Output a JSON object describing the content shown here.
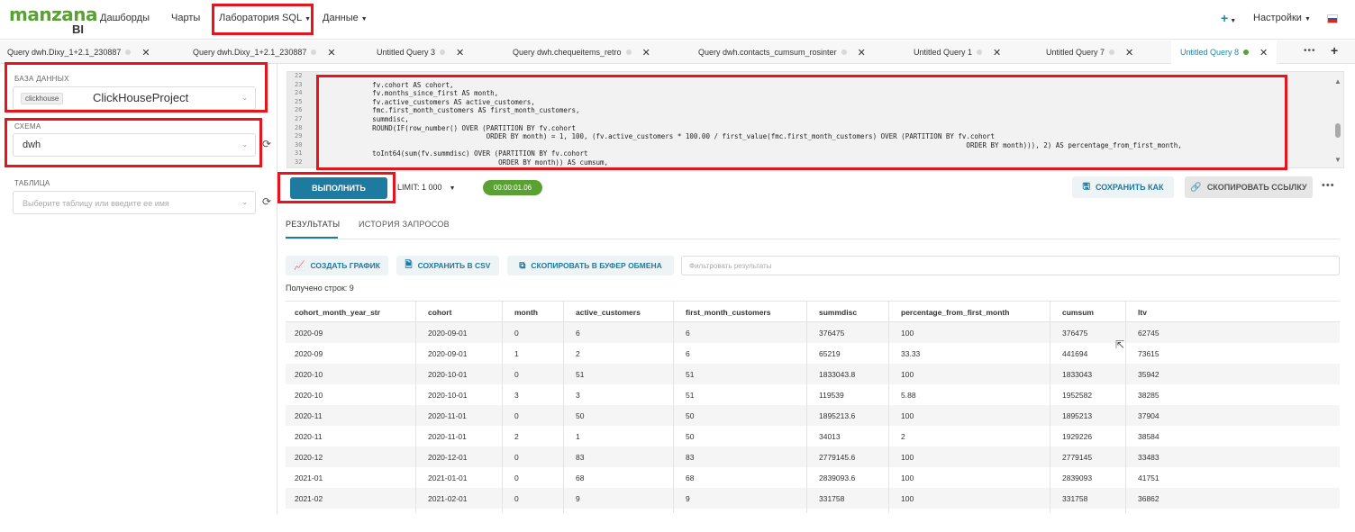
{
  "nav": {
    "brand": "manzana",
    "brand_sub": "BI",
    "items": [
      {
        "label": "Дашборды",
        "has_caret": false
      },
      {
        "label": "Чарты",
        "has_caret": false
      },
      {
        "label": "Лаборатория SQL",
        "has_caret": true
      },
      {
        "label": "Данные",
        "has_caret": true
      }
    ],
    "settings_label": "Настройки",
    "plus_label": "+"
  },
  "tabs": [
    {
      "label": "Query dwh.Dixy_1+2.1_230887"
    },
    {
      "label": "Query dwh.Dixy_1+2.1_230887"
    },
    {
      "label": "Untitled Query 3"
    },
    {
      "label": "Query dwh.chequeitems_retro"
    },
    {
      "label": "Query dwh.contacts_cumsum_rosinter"
    },
    {
      "label": "Untitled Query 1"
    },
    {
      "label": "Untitled Query 7"
    },
    {
      "label": "Untitled Query 8",
      "active": true
    }
  ],
  "left": {
    "db_label": "БАЗА ДАННЫХ",
    "db_tag": "clickhouse",
    "db_name": "ClickHouseProject",
    "schema_label": "СХЕМА",
    "schema_value": "dwh",
    "table_label": "ТАБЛИЦА",
    "table_placeholder": "Выберите таблицу или введите ее имя"
  },
  "editor": {
    "line_numbers": [
      "22",
      "23",
      "24",
      "25",
      "26",
      "27",
      "28",
      "29",
      "30",
      "31",
      "32"
    ],
    "lines": [
      "",
      "            fv.cohort AS cohort,",
      "            fv.months_since_first AS month,",
      "            fv.active_customers AS active_customers,",
      "            fmc.first_month_customers AS first_month_customers,",
      "            summdisc,",
      "            ROUND(IF(row_number() OVER (PARTITION BY fv.cohort",
      "                                        ORDER BY month) = 1, 100, (fv.active_customers * 100.00 / first_value(fmc.first_month_customers) OVER (PARTITION BY fv.cohort",
      "                                                                                                                                                              ORDER BY month))), 2) AS percentage_from_first_month,",
      "            toInt64(sum(fv.summdisc) OVER (PARTITION BY fv.cohort",
      "                                           ORDER BY month)) AS cumsum,"
    ]
  },
  "actions": {
    "run_label": "ВЫПОЛНИТЬ",
    "limit_label": "LIMIT:",
    "limit_value": "1 000",
    "timer": "00:00:01.06",
    "save_as_label": "СОХРАНИТЬ КАК",
    "copy_link_label": "СКОПИРОВАТЬ ССЫЛКУ"
  },
  "results": {
    "tabs": [
      "РЕЗУЛЬТАТЫ",
      "ИСТОРИЯ ЗАПРОСОВ"
    ],
    "create_chart_label": "СОЗДАТЬ ГРАФИК",
    "save_csv_label": "СОХРАНИТЬ В CSV",
    "copy_clipboard_label": "СКОПИРОВАТЬ В БУФЕР ОБМЕНА",
    "filter_placeholder": "Фильтровать результаты",
    "row_count": "Получено строк: 9",
    "columns": [
      "cohort_month_year_str",
      "cohort",
      "month",
      "active_customers",
      "first_month_customers",
      "summdisc",
      "percentage_from_first_month",
      "cumsum",
      "ltv"
    ],
    "rows": [
      [
        "2020-09",
        "2020-09-01",
        "0",
        "6",
        "6",
        "376475",
        "100",
        "376475",
        "62745"
      ],
      [
        "2020-09",
        "2020-09-01",
        "1",
        "2",
        "6",
        "65219",
        "33.33",
        "441694",
        "73615"
      ],
      [
        "2020-10",
        "2020-10-01",
        "0",
        "51",
        "51",
        "1833043.8",
        "100",
        "1833043",
        "35942"
      ],
      [
        "2020-10",
        "2020-10-01",
        "3",
        "3",
        "51",
        "119539",
        "5.88",
        "1952582",
        "38285"
      ],
      [
        "2020-11",
        "2020-11-01",
        "0",
        "50",
        "50",
        "1895213.6",
        "100",
        "1895213",
        "37904"
      ],
      [
        "2020-11",
        "2020-11-01",
        "2",
        "1",
        "50",
        "34013",
        "2",
        "1929226",
        "38584"
      ],
      [
        "2020-12",
        "2020-12-01",
        "0",
        "83",
        "83",
        "2779145.6",
        "100",
        "2779145",
        "33483"
      ],
      [
        "2021-01",
        "2021-01-01",
        "0",
        "68",
        "68",
        "2839093.6",
        "100",
        "2839093",
        "41751"
      ],
      [
        "2021-02",
        "2021-02-01",
        "0",
        "9",
        "9",
        "331758",
        "100",
        "331758",
        "36862"
      ]
    ]
  },
  "colors": {
    "accent": "#1f7aa0",
    "brand_green": "#5aa133",
    "highlight_red": "#e8141c"
  }
}
